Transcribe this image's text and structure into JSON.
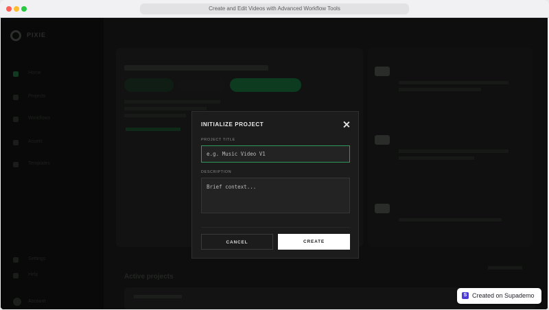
{
  "browser": {
    "tab_title": "Create and Edit Videos with Advanced Workflow Tools"
  },
  "sidebar": {
    "brand": "PIXIE",
    "items": [
      {
        "label": "Home",
        "icon": "home-icon",
        "active": true
      },
      {
        "label": "Projects",
        "icon": "folder-icon",
        "active": false
      },
      {
        "label": "Workflows",
        "icon": "workflow-icon",
        "active": false
      },
      {
        "label": "Assets",
        "icon": "image-icon",
        "active": false
      },
      {
        "label": "Templates",
        "icon": "template-icon",
        "active": false
      }
    ],
    "bottom_items": [
      {
        "label": "Settings",
        "icon": "gear-icon"
      },
      {
        "label": "Help",
        "icon": "help-icon"
      }
    ],
    "user_name": "Account"
  },
  "modal": {
    "title": "INITIALIZE PROJECT",
    "project_title_label": "PROJECT TITLE",
    "project_title_placeholder": "e.g. Music Video V1",
    "project_title_value": "",
    "description_label": "DESCRIPTION",
    "description_placeholder": "Brief context...",
    "description_value": "",
    "cancel_label": "CANCEL",
    "create_label": "CREATE"
  },
  "main": {
    "projects_heading": "Active projects"
  },
  "badge": {
    "text": "Created on Supademo",
    "icon_letter": "S"
  },
  "colors": {
    "accent_green": "#2f9a5c",
    "badge_brand": "#4b3cd8",
    "modal_bg": "#1b1c1b"
  }
}
